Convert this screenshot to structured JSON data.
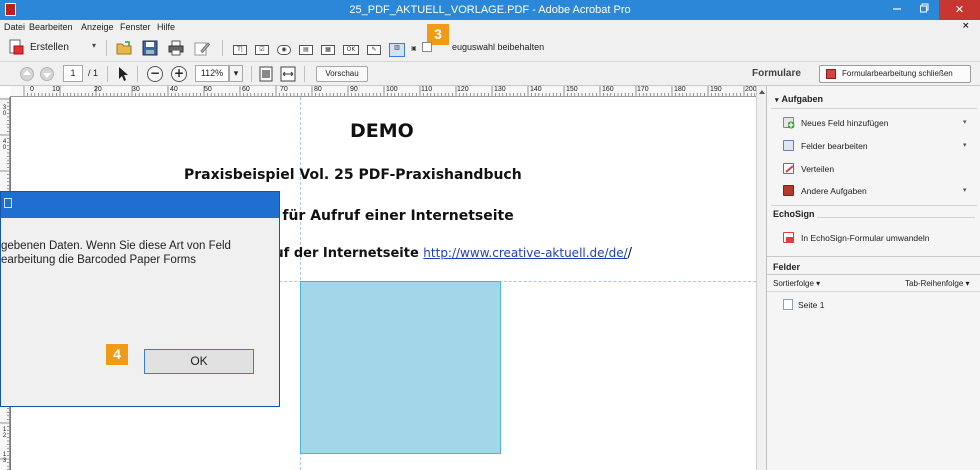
{
  "window": {
    "title": "25_PDF_AKTUELL_VORLAGE.PDF - Adobe Acrobat Pro",
    "min_icon": "minimize-icon",
    "max_icon": "maximize-icon",
    "close_glyph": "✕"
  },
  "menu": {
    "items": [
      "Datei",
      "Bearbeiten",
      "Anzeige",
      "Fenster",
      "Hilfe"
    ],
    "close_glyph": "×"
  },
  "toolbar1": {
    "create_label": "Erstellen",
    "create_caret": "▾",
    "form_field_icons": [
      "T|",
      "☑",
      "◉",
      "▤",
      "▦",
      "OK",
      "✎",
      "▥",
      "▣"
    ],
    "keep_tool_label": "euguswahl beibehalten"
  },
  "toolbar2": {
    "page_current": "1",
    "page_total": "/ 1",
    "zoom_out": "−",
    "zoom_in": "+",
    "zoom_value": "112%",
    "zoom_caret": "▾",
    "preview_label": "Vorschau"
  },
  "right_panel": {
    "header_label": "Formulare",
    "close_form_edit_label": "Formularbearbeitung schließen",
    "tasks_header": "Aufgaben",
    "tasks_collapse": "▾",
    "tasks": [
      {
        "label": "Neues Feld hinzufügen",
        "icon": "add-field-icon",
        "color": "#3a9d3a",
        "dropdown": "▾"
      },
      {
        "label": "Felder bearbeiten",
        "icon": "edit-fields-icon",
        "color": "#4a6fbf",
        "dropdown": "▾"
      },
      {
        "label": "Verteilen",
        "icon": "distribute-icon",
        "color": "#d94040",
        "dropdown": ""
      },
      {
        "label": "Andere Aufgaben",
        "icon": "briefcase-icon",
        "color": "#b33a2a",
        "dropdown": "▾"
      }
    ],
    "echosign_header": "EchoSign",
    "echosign_item": "In EchoSign-Formular umwandeln",
    "fields_header": "Felder",
    "sort_label": "Sortierfolge ▾",
    "tab_order_label": "Tab-Reihenfolge ▾",
    "page_node": "Seite 1"
  },
  "ruler": {
    "h_labels": [
      "0",
      "10",
      "20",
      "30",
      "40",
      "50",
      "60",
      "70",
      "80",
      "90",
      "100",
      "110",
      "120",
      "130",
      "140",
      "150",
      "160",
      "170",
      "180",
      "190",
      "200"
    ],
    "v_labels": [
      "3\n0",
      "4\n0",
      "1\n2",
      "1\n3"
    ]
  },
  "document": {
    "title": "DEMO",
    "subtitle": "Praxisbeispiel Vol. 25 PDF-Praxishandbuch",
    "heading": "e für Aufruf einer Internetseite",
    "line_prefix": "ruf der Internetseite ",
    "link": "http://www.creative-aktuell.de/de/",
    "line_suffix": "/"
  },
  "dialog": {
    "line1": "gebenen Daten. Wenn Sie diese Art von Feld",
    "line2": "earbeitung die Barcoded Paper Forms",
    "ok_label": "OK"
  },
  "badges": {
    "step3": "3",
    "step4": "4"
  },
  "colors": {
    "titlebar": "#2b88d9",
    "badge": "#f09a16",
    "form_field": "#a3d7e7",
    "link": "#1f3fbd"
  }
}
